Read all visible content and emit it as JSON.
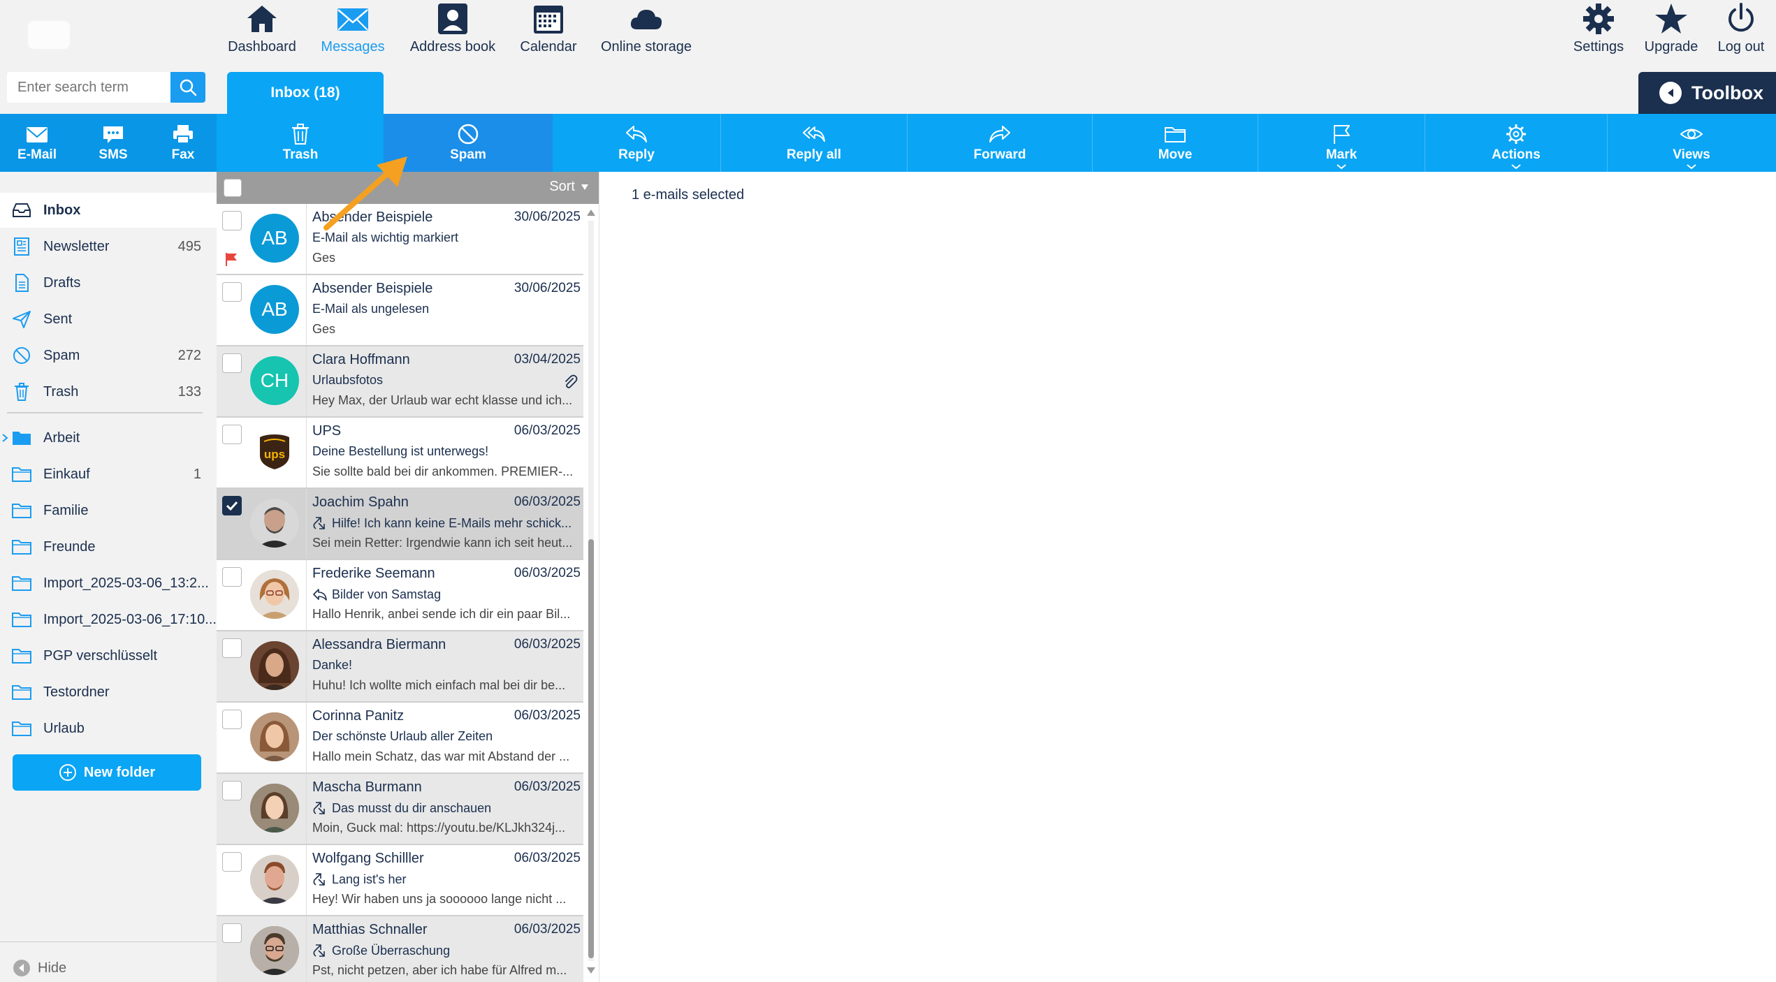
{
  "colors": {
    "primary": "#0aa5f5",
    "dark": "#1b2f4e",
    "active_tab": "#1a9cf0",
    "flag": "#e8463c",
    "arrow": "#f5a020"
  },
  "search": {
    "placeholder": "Enter search term"
  },
  "topnav": [
    {
      "label": "Dashboard",
      "icon": "home-icon"
    },
    {
      "label": "Messages",
      "icon": "envelope-icon",
      "active": true
    },
    {
      "label": "Address book",
      "icon": "contact-card-icon"
    },
    {
      "label": "Calendar",
      "icon": "calendar-icon"
    },
    {
      "label": "Online storage",
      "icon": "cloud-icon"
    }
  ],
  "topright": [
    {
      "label": "Settings",
      "icon": "gear-icon"
    },
    {
      "label": "Upgrade",
      "icon": "star-icon"
    },
    {
      "label": "Log out",
      "icon": "power-icon"
    }
  ],
  "inbox_tab": "Inbox (18)",
  "toolbox": "Toolbox",
  "compose": [
    {
      "label": "E-Mail",
      "icon": "envelope-icon"
    },
    {
      "label": "SMS",
      "icon": "chat-bubble-icon"
    },
    {
      "label": "Fax",
      "icon": "printer-icon"
    }
  ],
  "actions": [
    {
      "label": "Trash",
      "icon": "trash-icon"
    },
    {
      "label": "Spam",
      "icon": "block-icon"
    },
    {
      "label": "Reply",
      "icon": "reply-icon"
    },
    {
      "label": "Reply all",
      "icon": "reply-all-icon"
    },
    {
      "label": "Forward",
      "icon": "forward-icon"
    },
    {
      "label": "Move",
      "icon": "folder-icon"
    },
    {
      "label": "Mark",
      "icon": "flag-icon"
    },
    {
      "label": "Actions",
      "icon": "gear-icon"
    },
    {
      "label": "Views",
      "icon": "eye-icon"
    }
  ],
  "folders": [
    {
      "name": "Inbox",
      "count": "",
      "icon": "inbox-icon",
      "active": true
    },
    {
      "name": "Newsletter",
      "count": "495",
      "icon": "newsletter-icon"
    },
    {
      "name": "Drafts",
      "count": "",
      "icon": "document-icon"
    },
    {
      "name": "Sent",
      "count": "",
      "icon": "paper-plane-icon"
    },
    {
      "name": "Spam",
      "count": "272",
      "icon": "block-icon"
    },
    {
      "name": "Trash",
      "count": "133",
      "icon": "trash-icon"
    },
    {
      "name": "Arbeit",
      "count": "",
      "icon": "folder-filled-icon"
    },
    {
      "name": "Einkauf",
      "count": "1",
      "icon": "folder-icon"
    },
    {
      "name": "Familie",
      "count": "",
      "icon": "folder-icon"
    },
    {
      "name": "Freunde",
      "count": "",
      "icon": "folder-icon"
    },
    {
      "name": "Import_2025-03-06_13:2...",
      "count": "",
      "icon": "folder-icon"
    },
    {
      "name": "Import_2025-03-06_17:10...",
      "count": "",
      "icon": "folder-icon"
    },
    {
      "name": "PGP verschlüsselt",
      "count": "",
      "icon": "folder-icon"
    },
    {
      "name": "Testordner",
      "count": "",
      "icon": "folder-icon"
    },
    {
      "name": "Urlaub",
      "count": "",
      "icon": "folder-icon"
    }
  ],
  "new_folder": "New folder",
  "hide": "Hide",
  "list": {
    "sort": "Sort",
    "messages": [
      {
        "sender": "Absender Beispiele",
        "date": "30/06/2025",
        "subject": "E-Mail als wichtig markiert",
        "preview": "Ges",
        "avatar": "AB",
        "avatar_color": "#0a9ad6",
        "flagged": true
      },
      {
        "sender": "Absender Beispiele",
        "date": "30/06/2025",
        "subject": "E-Mail als ungelesen",
        "preview": "Ges",
        "avatar": "AB",
        "avatar_color": "#0a9ad6"
      },
      {
        "sender": "Clara Hoffmann",
        "date": "03/04/2025",
        "subject": "Urlaubsfotos",
        "preview": "Hey Max, der Urlaub war echt klasse und ich...",
        "avatar": "CH",
        "avatar_color": "#16c4b0",
        "attachment": true
      },
      {
        "sender": "UPS",
        "date": "06/03/2025",
        "subject": "Deine Bestellung ist unterwegs!",
        "preview": "Sie sollte bald bei dir ankommen. PREMIER-...",
        "avatar_logo": "ups"
      },
      {
        "sender": "Joachim Spahn",
        "date": "06/03/2025",
        "subject": "Hilfe! Ich kann keine E-Mails mehr schick...",
        "preview": "Sei mein Retter: Irgendwie kann ich seit heut...",
        "avatar_photo": "#5a5a5a",
        "status_icon": "forwarded-icon",
        "checked": true
      },
      {
        "sender": "Frederike Seemann",
        "date": "06/03/2025",
        "subject": "Bilder von Samstag",
        "preview": "Hallo Henrik, anbei sende ich dir ein paar Bil...",
        "avatar_photo": "#c98c5c",
        "status_icon": "replied-icon"
      },
      {
        "sender": "Alessandra Biermann",
        "date": "06/03/2025",
        "subject": "Danke!",
        "preview": "Huhu! Ich wollte mich einfach mal bei dir be...",
        "avatar_photo": "#7a4e36"
      },
      {
        "sender": "Corinna Panitz",
        "date": "06/03/2025",
        "subject": "Der schönste Urlaub aller Zeiten",
        "preview": "Hallo mein Schatz, das war mit Abstand der ...",
        "avatar_photo": "#a6785a"
      },
      {
        "sender": "Mascha Burmann",
        "date": "06/03/2025",
        "subject": "Das musst du dir anschauen",
        "preview": "Moin, Guck mal: https://youtu.be/KLJkh324j...",
        "avatar_photo": "#8a6a52",
        "status_icon": "forwarded-icon"
      },
      {
        "sender": "Wolfgang Schilller",
        "date": "06/03/2025",
        "subject": "Lang ist's her",
        "preview": "Hey! Wir haben uns ja soooooo lange nicht ...",
        "avatar_photo": "#b0705a",
        "status_icon": "forwarded-icon"
      },
      {
        "sender": "Matthias Schnaller",
        "date": "06/03/2025",
        "subject": "Große Überraschung",
        "preview": "Pst, nicht petzen, aber ich habe für Alfred m...",
        "avatar_photo": "#6a5a4a",
        "status_icon": "forwarded-icon"
      }
    ]
  },
  "detail": {
    "selected_text": "1 e-mails selected"
  }
}
